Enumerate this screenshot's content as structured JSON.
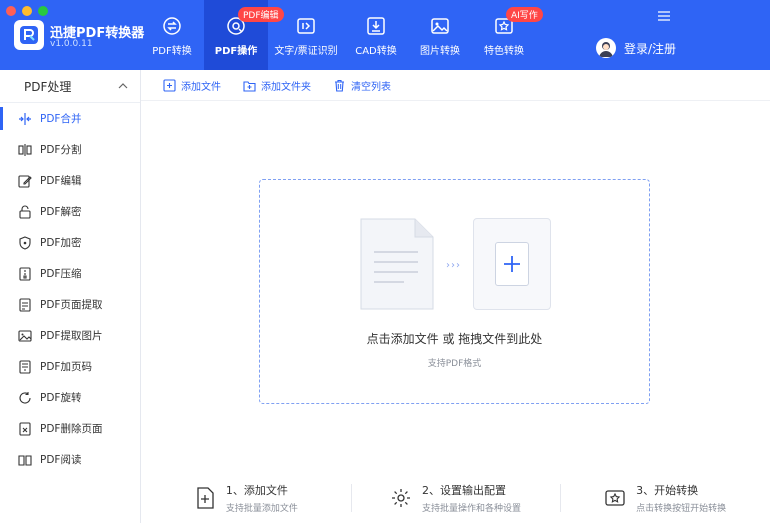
{
  "app": {
    "title": "迅捷PDF转换器",
    "version": "v1.0.0.11"
  },
  "nav": [
    {
      "label": "PDF转换",
      "icon": "convert-icon",
      "badge": ""
    },
    {
      "label": "PDF操作",
      "icon": "pdf-operate-icon",
      "badge": "PDF编辑",
      "active": true
    },
    {
      "label": "文字/票证识别",
      "icon": "ocr-icon",
      "badge": ""
    },
    {
      "label": "CAD转换",
      "icon": "cad-icon",
      "badge": ""
    },
    {
      "label": "图片转换",
      "icon": "image-icon",
      "badge": ""
    },
    {
      "label": "特色转换",
      "icon": "special-icon",
      "badge": "AI写作"
    }
  ],
  "header": {
    "login_label": "登录/注册"
  },
  "sidebar": {
    "title": "PDF处理",
    "items": [
      {
        "label": "PDF合并",
        "icon": "merge-icon",
        "active": true
      },
      {
        "label": "PDF分割",
        "icon": "split-icon"
      },
      {
        "label": "PDF编辑",
        "icon": "edit-icon"
      },
      {
        "label": "PDF解密",
        "icon": "unlock-icon"
      },
      {
        "label": "PDF加密",
        "icon": "shield-icon"
      },
      {
        "label": "PDF压缩",
        "icon": "compress-icon"
      },
      {
        "label": "PDF页面提取",
        "icon": "extract-page-icon"
      },
      {
        "label": "PDF提取图片",
        "icon": "extract-image-icon"
      },
      {
        "label": "PDF加页码",
        "icon": "page-number-icon"
      },
      {
        "label": "PDF旋转",
        "icon": "rotate-icon"
      },
      {
        "label": "PDF删除页面",
        "icon": "delete-page-icon"
      },
      {
        "label": "PDF阅读",
        "icon": "read-icon"
      }
    ]
  },
  "toolbar": {
    "add_file": "添加文件",
    "add_folder": "添加文件夹",
    "clear_list": "清空列表"
  },
  "dropzone": {
    "main_text": "点击添加文件 或 拖拽文件到此处",
    "sub_text": "支持PDF格式",
    "arrows": "›››"
  },
  "steps": [
    {
      "title": "1、添加文件",
      "sub": "支持批量添加文件",
      "icon": "add-file-icon"
    },
    {
      "title": "2、设置输出配置",
      "sub": "支持批量操作和各种设置",
      "icon": "settings-icon"
    },
    {
      "title": "3、开始转换",
      "sub": "点击转换按钮开始转换",
      "icon": "start-convert-icon"
    }
  ],
  "colors": {
    "brand": "#2f64f5",
    "brand_dark": "#1f4bd8",
    "badge": "#ff4646"
  }
}
